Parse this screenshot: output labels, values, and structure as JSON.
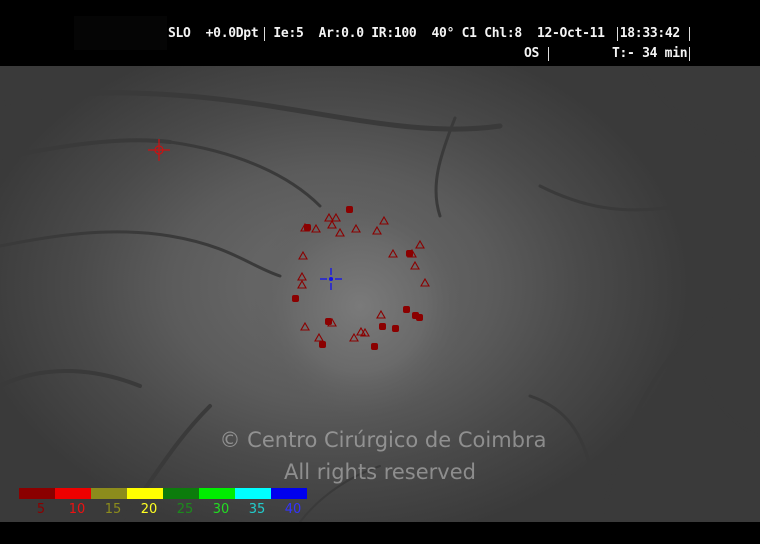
{
  "hud": {
    "mode": "SLO",
    "diopter": "+0.0Dpt",
    "focus": "Ie:5",
    "ar": "Ar:0.0",
    "ir": "IR:100",
    "angle": "40°",
    "c1": "C1",
    "chl": "Chl:8",
    "date": "12-Oct-11",
    "time": "18:33:42",
    "eye": "OS",
    "duration": "T:- 34 min"
  },
  "watermark": {
    "line1": "© Centro Cirúrgico de Coimbra",
    "line2": "All rights reserved"
  },
  "legend": [
    {
      "label": "5",
      "color": "#8b0000",
      "text_color": "#8b0000"
    },
    {
      "label": "10",
      "color": "#ee0000",
      "text_color": "#ee1111"
    },
    {
      "label": "15",
      "color": "#8c8c1c",
      "text_color": "#8c8c1c"
    },
    {
      "label": "20",
      "color": "#ffff00",
      "text_color": "#ffff22"
    },
    {
      "label": "25",
      "color": "#0c7c0c",
      "text_color": "#1b8b1b"
    },
    {
      "label": "30",
      "color": "#00ee00",
      "text_color": "#22dd22"
    },
    {
      "label": "35",
      "color": "#00ffff",
      "text_color": "#22cccc"
    },
    {
      "label": "40",
      "color": "#0000ee",
      "text_color": "#3333ff"
    }
  ],
  "colors": {
    "marker": "#8b0000",
    "fixation_target": "#0000ee",
    "reference_target": "#cc1111"
  }
}
